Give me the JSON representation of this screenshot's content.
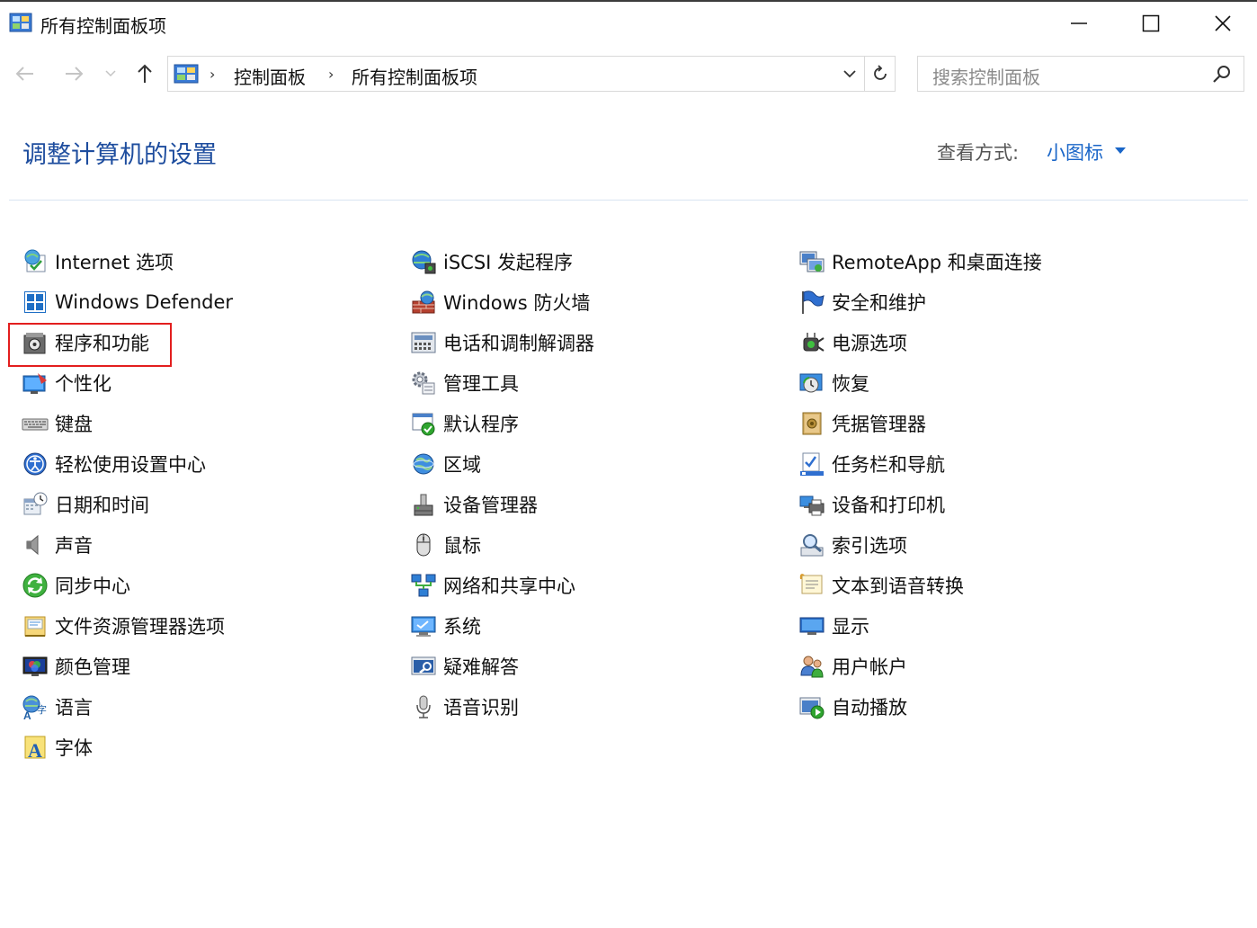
{
  "window": {
    "title": "所有控制面板项"
  },
  "address": {
    "crumbs": [
      "控制面板",
      "所有控制面板项"
    ]
  },
  "search": {
    "placeholder": "搜索控制面板"
  },
  "header": {
    "title": "调整计算机的设置",
    "view_by_label": "查看方式:",
    "view_by_value": "小图标"
  },
  "colors": {
    "title_blue": "#1e4d9e",
    "link_blue": "#1a66c8",
    "highlight_red": "#e31e1e"
  },
  "items": {
    "col1": [
      {
        "label": "Internet 选项",
        "icon": "internet-options-icon"
      },
      {
        "label": "Windows Defender",
        "icon": "windows-defender-icon"
      },
      {
        "label": "程序和功能",
        "icon": "programs-features-icon"
      },
      {
        "label": "个性化",
        "icon": "personalization-icon"
      },
      {
        "label": "键盘",
        "icon": "keyboard-icon"
      },
      {
        "label": "轻松使用设置中心",
        "icon": "ease-of-access-icon"
      },
      {
        "label": "日期和时间",
        "icon": "date-time-icon"
      },
      {
        "label": "声音",
        "icon": "sound-icon"
      },
      {
        "label": "同步中心",
        "icon": "sync-center-icon"
      },
      {
        "label": "文件资源管理器选项",
        "icon": "file-explorer-options-icon"
      },
      {
        "label": "颜色管理",
        "icon": "color-management-icon"
      },
      {
        "label": "语言",
        "icon": "language-icon"
      },
      {
        "label": "字体",
        "icon": "fonts-icon"
      }
    ],
    "col2": [
      {
        "label": "iSCSI 发起程序",
        "icon": "iscsi-initiator-icon"
      },
      {
        "label": "Windows 防火墙",
        "icon": "firewall-icon"
      },
      {
        "label": "电话和调制解调器",
        "icon": "phone-modem-icon"
      },
      {
        "label": "管理工具",
        "icon": "admin-tools-icon"
      },
      {
        "label": "默认程序",
        "icon": "default-programs-icon"
      },
      {
        "label": "区域",
        "icon": "region-icon"
      },
      {
        "label": "设备管理器",
        "icon": "device-manager-icon"
      },
      {
        "label": "鼠标",
        "icon": "mouse-icon"
      },
      {
        "label": "网络和共享中心",
        "icon": "network-sharing-icon"
      },
      {
        "label": "系统",
        "icon": "system-icon"
      },
      {
        "label": "疑难解答",
        "icon": "troubleshooting-icon"
      },
      {
        "label": "语音识别",
        "icon": "speech-recognition-icon"
      }
    ],
    "col3": [
      {
        "label": "RemoteApp 和桌面连接",
        "icon": "remoteapp-icon"
      },
      {
        "label": "安全和维护",
        "icon": "security-maintenance-icon"
      },
      {
        "label": "电源选项",
        "icon": "power-options-icon"
      },
      {
        "label": "恢复",
        "icon": "recovery-icon"
      },
      {
        "label": "凭据管理器",
        "icon": "credential-manager-icon"
      },
      {
        "label": "任务栏和导航",
        "icon": "taskbar-navigation-icon"
      },
      {
        "label": "设备和打印机",
        "icon": "devices-printers-icon"
      },
      {
        "label": "索引选项",
        "icon": "indexing-options-icon"
      },
      {
        "label": "文本到语音转换",
        "icon": "text-to-speech-icon"
      },
      {
        "label": "显示",
        "icon": "display-icon"
      },
      {
        "label": "用户帐户",
        "icon": "user-accounts-icon"
      },
      {
        "label": "自动播放",
        "icon": "autoplay-icon"
      }
    ]
  }
}
